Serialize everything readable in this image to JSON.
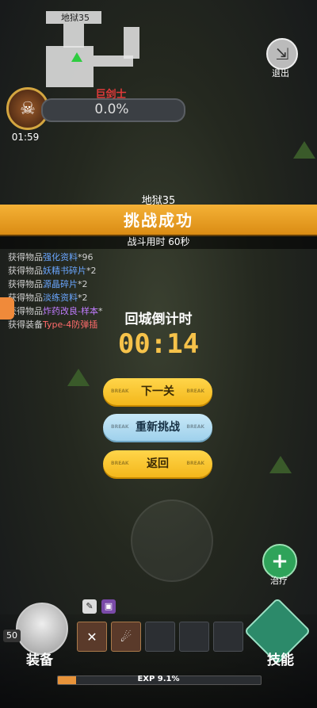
{
  "map": {
    "label": "地狱35"
  },
  "exit": {
    "label": "退出"
  },
  "boss": {
    "name": "巨剑士",
    "hp_text": "0.0%",
    "timer": "01:59"
  },
  "result": {
    "stage": "地狱35",
    "title": "挑战成功",
    "battle_time": "战斗用时 60秒"
  },
  "loot": [
    {
      "prefix": "获得物品",
      "item": "强化资料",
      "count": "*96",
      "color": "blue"
    },
    {
      "prefix": "获得物品",
      "item": "妖精书碎片",
      "count": "*2",
      "color": "blue"
    },
    {
      "prefix": "获得物品",
      "item": "源晶碎片",
      "count": "*2",
      "color": "blue"
    },
    {
      "prefix": "获得物品",
      "item": "淡练资料",
      "count": "*2",
      "color": "blue"
    },
    {
      "prefix": "获得物品",
      "item": "炸药改良-样本",
      "count": "*",
      "color": "purple"
    },
    {
      "prefix": "获得装备",
      "item": "Type-4防弹插",
      "count": "",
      "color": "red"
    }
  ],
  "countdown": {
    "label": "回城倒计时",
    "time": "00:14"
  },
  "buttons": {
    "next": "下一关",
    "retry": "重新挑战",
    "return": "返回",
    "deco": "BREAK"
  },
  "heal": {
    "label": "治疗"
  },
  "player": {
    "level": "50",
    "equip_label": "装备",
    "skill_label": "技能"
  },
  "exp": {
    "text": "EXP 9.1%",
    "fraction": 0.091
  },
  "colors": {
    "accent": "#f3b71b",
    "banner": "#e8a020",
    "boss_name": "#e23a3a"
  }
}
